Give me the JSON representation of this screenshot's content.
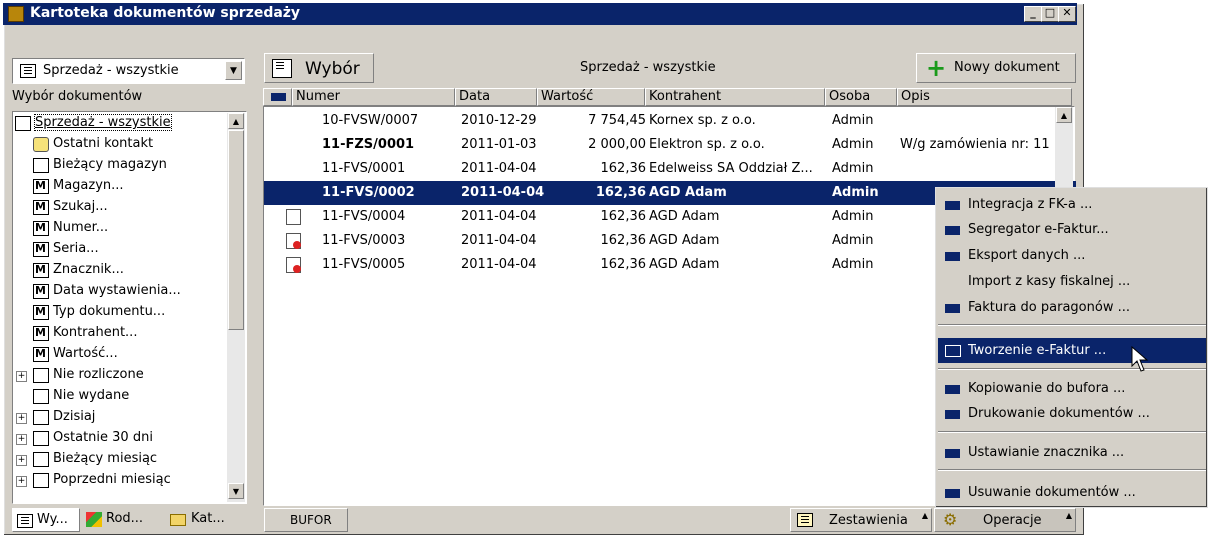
{
  "window": {
    "title": "Kartoteka dokumentów sprzedaży"
  },
  "left_panel": {
    "combo_value": "Sprzedaż - wszystkie",
    "section_label": "Wybór dokumentów",
    "tree": [
      {
        "label": "Sprzedaż - wszystkie",
        "icon": "document-list-icon",
        "level": 0
      },
      {
        "label": "Ostatni kontakt",
        "icon": "recent-contact-icon",
        "level": 1
      },
      {
        "label": "Bieżący magazyn",
        "icon": "document-icon",
        "level": 1
      },
      {
        "label": "Magazyn...",
        "icon": "binoculars-icon",
        "level": 1
      },
      {
        "label": "Szukaj...",
        "icon": "binoculars-icon",
        "level": 1
      },
      {
        "label": "Numer...",
        "icon": "binoculars-icon",
        "level": 1
      },
      {
        "label": "Seria...",
        "icon": "binoculars-icon",
        "level": 1
      },
      {
        "label": "Znacznik...",
        "icon": "binoculars-icon",
        "level": 1
      },
      {
        "label": "Data wystawienia...",
        "icon": "binoculars-icon",
        "level": 1
      },
      {
        "label": "Typ dokumentu...",
        "icon": "binoculars-icon",
        "level": 1
      },
      {
        "label": "Kontrahent...",
        "icon": "binoculars-icon",
        "level": 1
      },
      {
        "label": "Wartość...",
        "icon": "binoculars-icon",
        "level": 1
      },
      {
        "label": "Nie rozliczone",
        "icon": "document-icon",
        "level": 1,
        "expand": true
      },
      {
        "label": "Nie wydane",
        "icon": "document-icon",
        "level": 1
      },
      {
        "label": "Dzisiaj",
        "icon": "document-icon",
        "level": 1,
        "expand": true
      },
      {
        "label": "Ostatnie 30 dni",
        "icon": "document-icon",
        "level": 1,
        "expand": true
      },
      {
        "label": "Bieżący miesiąc",
        "icon": "document-icon",
        "level": 1,
        "expand": true
      },
      {
        "label": "Poprzedni miesiąc",
        "icon": "document-icon",
        "level": 1,
        "expand": true
      }
    ],
    "tabs": [
      "Wy...",
      "Rod...",
      "Kat..."
    ]
  },
  "main": {
    "mode_label": "Wybór",
    "filter_caption": "Sprzedaż - wszystkie",
    "new_doc_label": "Nowy dokument",
    "columns": [
      "Numer",
      "Data",
      "Wartość",
      "Kontrahent",
      "Osoba",
      "Opis"
    ],
    "rows": [
      {
        "numer": "10-FVSW/0007",
        "data": "2010-12-29",
        "wartosc": "7 754,45",
        "kontrahent": "Kornex sp. z o.o.",
        "osoba": "Admin",
        "opis": "",
        "icon": "",
        "bold": false,
        "selected": false
      },
      {
        "numer": "11-FZS/0001",
        "data": "2011-01-03",
        "wartosc": "2 000,00",
        "kontrahent": "Elektron sp. z o.o.",
        "osoba": "Admin",
        "opis": "W/g zamówienia nr: 11",
        "icon": "",
        "bold": true,
        "selected": false
      },
      {
        "numer": "11-FVS/0001",
        "data": "2011-04-04",
        "wartosc": "162,36",
        "kontrahent": "Edelweiss SA Oddział Z...",
        "osoba": "Admin",
        "opis": "",
        "icon": "",
        "bold": false,
        "selected": false
      },
      {
        "numer": "11-FVS/0002",
        "data": "2011-04-04",
        "wartosc": "162,36",
        "kontrahent": "AGD Adam",
        "osoba": "Admin",
        "opis": "",
        "icon": "",
        "bold": true,
        "selected": true
      },
      {
        "numer": "11-FVS/0004",
        "data": "2011-04-04",
        "wartosc": "162,36",
        "kontrahent": "AGD Adam",
        "osoba": "Admin",
        "opis": "",
        "icon": "edoc-icon",
        "bold": false,
        "selected": false
      },
      {
        "numer": "11-FVS/0003",
        "data": "2011-04-04",
        "wartosc": "162,36",
        "kontrahent": "AGD Adam",
        "osoba": "Admin",
        "opis": "",
        "icon": "edoc-error-icon",
        "bold": false,
        "selected": false
      },
      {
        "numer": "11-FVS/0005",
        "data": "2011-04-04",
        "wartosc": "162,36",
        "kontrahent": "AGD Adam",
        "osoba": "Admin",
        "opis": "",
        "icon": "edoc-error-icon",
        "bold": false,
        "selected": false
      }
    ],
    "bufor_label": "BUFOR",
    "zestawienia_label": "Zestawienia",
    "operacje_label": "Operacje"
  },
  "context_menu": {
    "items": [
      {
        "label": "Integracja z FK-a ...",
        "square": true
      },
      {
        "label": "Segregator e-Faktur...",
        "square": true
      },
      {
        "label": "Eksport danych ...",
        "square": true
      },
      {
        "label": "Import z kasy fiskalnej ...",
        "square": false
      },
      {
        "label": "Faktura do paragonów ...",
        "square": true
      },
      {
        "label": "Tworzenie e-Faktur ...",
        "square": true,
        "highlighted": true
      },
      {
        "label": "Kopiowanie do bufora ...",
        "square": true
      },
      {
        "label": "Drukowanie dokumentów ...",
        "square": true
      },
      {
        "label": "Ustawianie znacznika ...",
        "square": true
      },
      {
        "label": "Usuwanie dokumentów ...",
        "square": true
      }
    ]
  },
  "colors": {
    "titlebar": "#0a246a",
    "selection": "#0a246a",
    "face": "#d4d0c8",
    "green_plus": "#1a9a1a"
  }
}
